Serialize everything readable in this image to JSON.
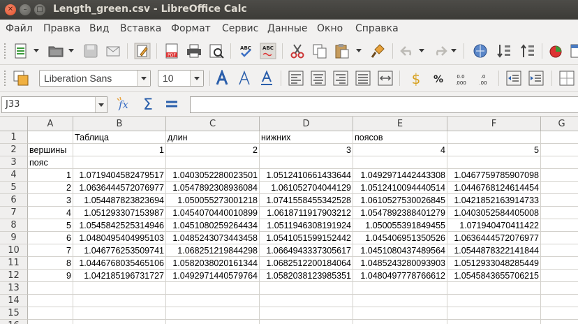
{
  "window": {
    "title": "Length_green.csv - LibreOffice Calc"
  },
  "menu": [
    "Файл",
    "Правка",
    "Вид",
    "Вставка",
    "Формат",
    "Сервис",
    "Данные",
    "Окно",
    "Справка"
  ],
  "formatting": {
    "font_name": "Liberation Sans",
    "font_size": "10"
  },
  "formula_bar": {
    "cell_ref": "J33",
    "content": ""
  },
  "sheet": {
    "columns": [
      "A",
      "B",
      "C",
      "D",
      "E",
      "F",
      "G"
    ],
    "rows": [
      {
        "num": "1",
        "cells": [
          "",
          "Таблица",
          "длин",
          "нижних",
          "поясов",
          "",
          ""
        ]
      },
      {
        "num": "2",
        "cells": [
          "вершины",
          "1",
          "2",
          "3",
          "4",
          "5",
          ""
        ]
      },
      {
        "num": "3",
        "cells": [
          "пояс",
          "",
          "",
          "",
          "",
          "",
          ""
        ]
      },
      {
        "num": "4",
        "cells": [
          "1",
          "1.0719404582479517",
          "1.0403052280023501",
          "1.0512410661433644",
          "1.0492971442443308",
          "1.0467759785907098",
          ""
        ]
      },
      {
        "num": "5",
        "cells": [
          "2",
          "1.0636444572076977",
          "1.0547892308936084",
          "1.061052704044129",
          "1.0512410094440514",
          "1.0446768124614454",
          ""
        ]
      },
      {
        "num": "6",
        "cells": [
          "3",
          "1.054487823823694",
          "1.050055273001218",
          "1.0741558455342528",
          "1.0610527530026845",
          "1.0421852163914733",
          ""
        ]
      },
      {
        "num": "7",
        "cells": [
          "4",
          "1.051293307153987",
          "1.0454070440010899",
          "1.0618711917903212",
          "1.0547892388401279",
          "1.0403052584405008",
          ""
        ]
      },
      {
        "num": "8",
        "cells": [
          "5",
          "1.0545842525314946",
          "1.0451080259264434",
          "1.0511946308191924",
          "1.050055391849455",
          "1.071940470411422",
          ""
        ]
      },
      {
        "num": "9",
        "cells": [
          "6",
          "1.0480495404995103",
          "1.0485243073443458",
          "1.0541051599152442",
          "1.045406951350526",
          "1.0636444572076977",
          ""
        ]
      },
      {
        "num": "10",
        "cells": [
          "7",
          "1.046776253509741",
          "1.068251219844298",
          "1.0664943337305617",
          "1.0451080437489564",
          "1.0544878322141844",
          ""
        ]
      },
      {
        "num": "11",
        "cells": [
          "8",
          "1.0446768035465106",
          "1.0582038020161344",
          "1.0682512200184064",
          "1.0485243280093903",
          "1.0512933048285449",
          ""
        ]
      },
      {
        "num": "12",
        "cells": [
          "9",
          "1.042185196731727",
          "1.0492971440579764",
          "1.0582038123985351",
          "1.0480497778766612",
          "1.0545843655706215",
          ""
        ]
      },
      {
        "num": "13",
        "cells": [
          "",
          "",
          "",
          "",
          "",
          "",
          ""
        ]
      },
      {
        "num": "14",
        "cells": [
          "",
          "",
          "",
          "",
          "",
          "",
          ""
        ]
      },
      {
        "num": "15",
        "cells": [
          "",
          "",
          "",
          "",
          "",
          "",
          ""
        ]
      },
      {
        "num": "16",
        "cells": [
          "",
          "",
          "",
          "",
          "",
          "",
          ""
        ]
      }
    ]
  }
}
